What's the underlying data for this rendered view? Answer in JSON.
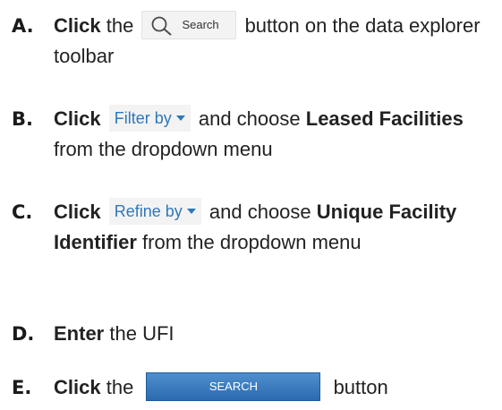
{
  "steps": [
    {
      "letter": "A.",
      "verb": "Click",
      "pre": "the",
      "button_label": "Search",
      "button_icon": "search-icon",
      "post": "button on the data explorer toolbar"
    },
    {
      "letter": "B.",
      "verb": "Click",
      "dropdown_label": "Filter by",
      "post1": "and choose",
      "bold_term": "Leased Facilities",
      "post2": "from the dropdown menu"
    },
    {
      "letter": "C.",
      "verb": "Click",
      "dropdown_label": "Refine by",
      "post1": "and choose",
      "bold_term": "Unique Facility Identifier",
      "post2": "from the dropdown menu"
    },
    {
      "letter": "D.",
      "verb": "Enter",
      "post": "the UFI"
    },
    {
      "letter": "E.",
      "verb": "Click",
      "pre": "the",
      "button_label": "SEARCH",
      "post": "button"
    }
  ],
  "colors": {
    "link_blue": "#2f78b8",
    "search_button_blue": "#2a6aae"
  }
}
